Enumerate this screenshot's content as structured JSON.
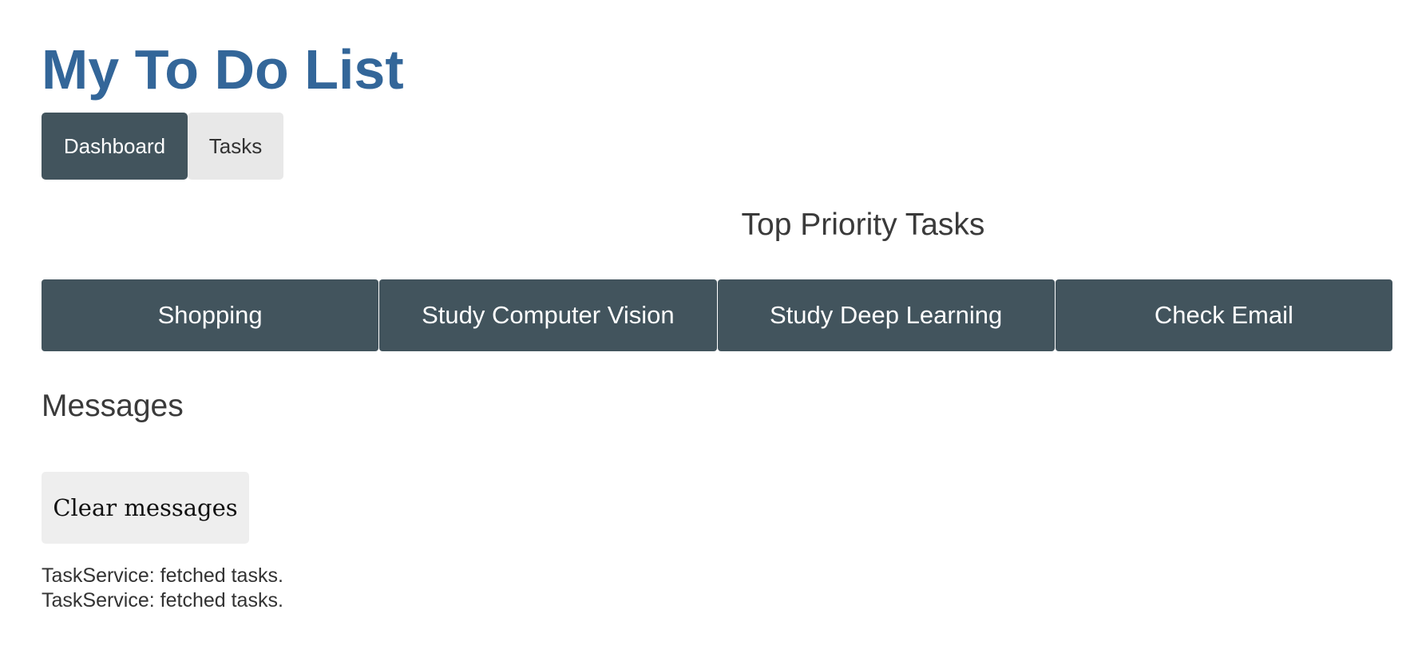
{
  "app": {
    "title": "My To Do List"
  },
  "nav": {
    "items": [
      {
        "label": "Dashboard",
        "active": true
      },
      {
        "label": "Tasks",
        "active": false
      }
    ]
  },
  "dashboard": {
    "heading": "Top Priority Tasks",
    "tasks": [
      {
        "label": "Shopping"
      },
      {
        "label": "Study Computer Vision"
      },
      {
        "label": "Study Deep Learning"
      },
      {
        "label": "Check Email"
      }
    ]
  },
  "messages": {
    "heading": "Messages",
    "clear_label": "Clear messages",
    "items": [
      "TaskService: fetched tasks.",
      "TaskService: fetched tasks."
    ]
  },
  "colors": {
    "title": "#336699",
    "nav_active_bg": "#42545d",
    "nav_inactive_bg": "#e8e8e8",
    "task_tile_bg": "#42545d",
    "clear_button_bg": "#eeeeee"
  }
}
